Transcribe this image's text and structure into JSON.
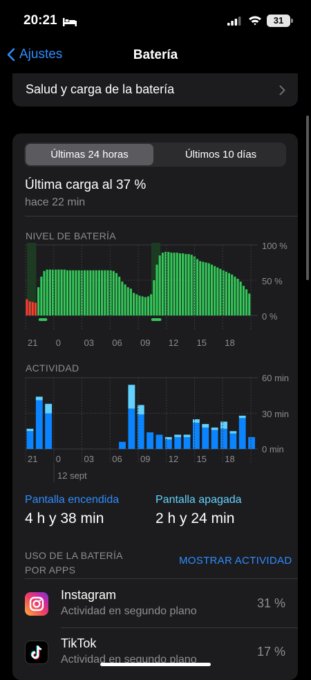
{
  "status": {
    "time": "20:21",
    "battery_level": "31",
    "icons": [
      "bed-icon",
      "signal-icon",
      "wifi-icon",
      "battery-icon"
    ]
  },
  "nav": {
    "back_label": "Ajustes",
    "title": "Batería"
  },
  "health_row": {
    "label": "Salud y carga de la batería"
  },
  "segmented": {
    "active": "Últimas 24 horas",
    "inactive": "Últimos 10 días"
  },
  "last_charge": {
    "title": "Última carga al 37 %",
    "time": "hace 22 min"
  },
  "battery_chart": {
    "section_label": "NIVEL DE BATERÍA",
    "y_labels": [
      "100 %",
      "50 %",
      "0 %"
    ]
  },
  "activity_chart": {
    "section_label": "ACTIVIDAD",
    "y_labels": [
      "60 min",
      "30 min",
      "0 min"
    ],
    "date_label": "12 sept"
  },
  "x_labels": [
    "21",
    "0",
    "03",
    "06",
    "09",
    "12",
    "15",
    "18"
  ],
  "stats": {
    "screen_on_label": "Pantalla encendida",
    "screen_on_value": "4 h y 38 min",
    "screen_off_label": "Pantalla apagada",
    "screen_off_value": "2 h y 24 min"
  },
  "usage": {
    "title": "USO DE LA BATERÍA POR APPS",
    "show_activity": "MOSTRAR ACTIVIDAD",
    "apps": [
      {
        "name": "Instagram",
        "sub": "Actividad en segundo plano",
        "pct": "31 %"
      },
      {
        "name": "TikTok",
        "sub": "Actividad en segundo plano",
        "pct": "17 %"
      }
    ]
  },
  "colors": {
    "accent": "#2f8cff",
    "battery_green": "#34c759",
    "battery_red": "#ff3b30",
    "screen_on_blue": "#0a84ff",
    "screen_off_cyan": "#64d2ff"
  },
  "chart_data": [
    {
      "type": "bar",
      "title": "NIVEL DE BATERÍA",
      "x_ticks": [
        "21",
        "0",
        "03",
        "06",
        "09",
        "12",
        "15",
        "18"
      ],
      "ylim": [
        0,
        100
      ],
      "y_ticks": [
        "100 %",
        "50 %",
        "0 %"
      ],
      "values": [
        23,
        20,
        19,
        18,
        40,
        55,
        63,
        65,
        65,
        65,
        65,
        65,
        65,
        65,
        64,
        64,
        64,
        64,
        64,
        64,
        64,
        64,
        64,
        64,
        64,
        64,
        64,
        64,
        64,
        64,
        63,
        60,
        55,
        48,
        44,
        40,
        38,
        32,
        30,
        28,
        27,
        26,
        27,
        30,
        50,
        72,
        85,
        89,
        90,
        90,
        89,
        89,
        89,
        88,
        88,
        87,
        87,
        86,
        84,
        80,
        77,
        76,
        75,
        74,
        72,
        70,
        68,
        66,
        64,
        62,
        60,
        58,
        55,
        52,
        48,
        42,
        37,
        31
      ],
      "low_battery_bars": 4,
      "charging_bands": [
        "21",
        "09"
      ]
    },
    {
      "type": "bar",
      "title": "ACTIVIDAD",
      "x_ticks": [
        "21",
        "0",
        "03",
        "06",
        "09",
        "12",
        "15",
        "18"
      ],
      "ylim": [
        0,
        60
      ],
      "y_ticks": [
        "60 min",
        "30 min",
        "0 min"
      ],
      "categories_note": "hourly bars",
      "series": [
        {
          "name": "Pantalla encendida",
          "values": [
            15,
            41,
            30,
            0,
            0,
            0,
            0,
            0,
            0,
            0,
            6,
            34,
            29,
            14,
            12,
            8,
            10,
            10,
            22,
            18,
            16,
            17,
            13,
            26,
            10
          ]
        },
        {
          "name": "Pantalla apagada",
          "values": [
            2,
            3,
            8,
            0,
            0,
            0,
            0,
            0,
            0,
            0,
            0,
            20,
            8,
            0,
            0,
            2,
            2,
            2,
            3,
            3,
            2,
            6,
            2,
            2,
            0
          ]
        }
      ]
    }
  ]
}
